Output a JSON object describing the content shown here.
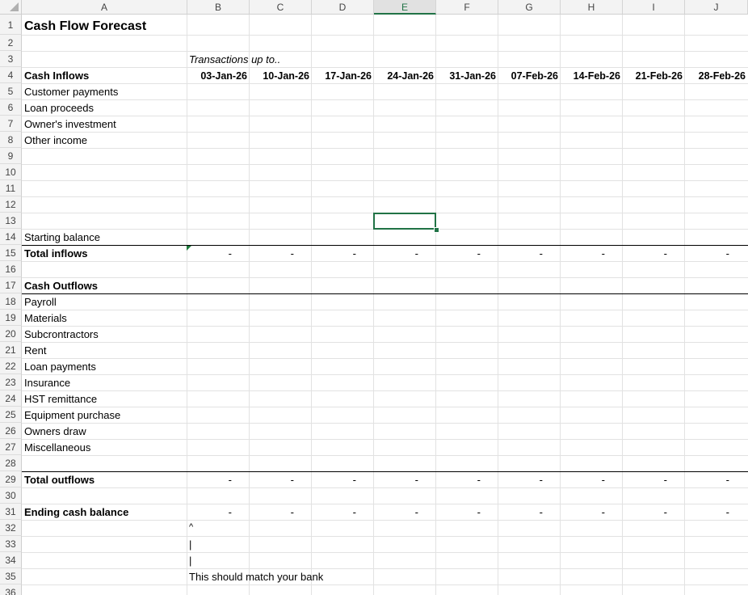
{
  "columns": [
    "A",
    "B",
    "C",
    "D",
    "E",
    "F",
    "G",
    "H",
    "I",
    "J"
  ],
  "selected_column": "E",
  "row_numbers": [
    "1",
    "2",
    "3",
    "4",
    "5",
    "6",
    "7",
    "8",
    "9",
    "10",
    "11",
    "12",
    "13",
    "14",
    "15",
    "16",
    "17",
    "18",
    "19",
    "20",
    "21",
    "22",
    "23",
    "24",
    "25",
    "26",
    "27",
    "28",
    "29",
    "30",
    "31",
    "32",
    "33",
    "34",
    "35",
    "36"
  ],
  "title": "Cash Flow Forecast",
  "header_note": "Transactions up to..",
  "dates": [
    "03-Jan-26",
    "10-Jan-26",
    "17-Jan-26",
    "24-Jan-26",
    "31-Jan-26",
    "07-Feb-26",
    "14-Feb-26",
    "21-Feb-26",
    "28-Feb-26"
  ],
  "inflows": {
    "heading": "Cash Inflows",
    "items": [
      "Customer payments",
      "Loan proceeds",
      "Owner's investment",
      "Other income"
    ],
    "starting_balance": "Starting balance",
    "total_label": "Total inflows"
  },
  "outflows": {
    "heading": "Cash Outflows",
    "items": [
      "Payroll",
      "Materials",
      "Subcrontractors",
      "Rent",
      "Loan payments",
      "Insurance",
      "HST remittance",
      "Equipment purchase",
      "Owners draw",
      "Miscellaneous"
    ],
    "total_label": "Total outflows"
  },
  "ending_label": "Ending cash balance",
  "dash": "-",
  "annotation": {
    "caret": "^",
    "bar1": "|",
    "bar2": "|",
    "text": "This should match your bank"
  }
}
